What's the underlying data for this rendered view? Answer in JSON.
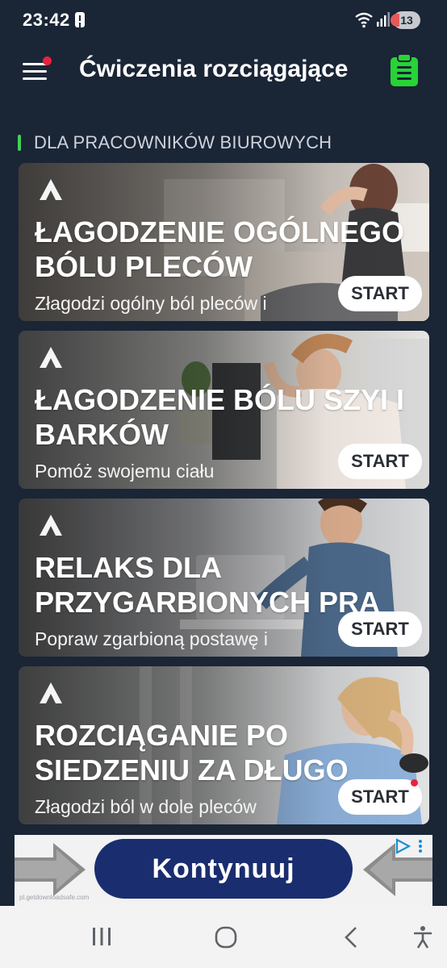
{
  "status": {
    "time": "23:42",
    "battery": "13"
  },
  "app": {
    "title": "Ćwiczenia rozciągające"
  },
  "section": {
    "title": "DLA PRACOWNIKÓW BIUROWYCH"
  },
  "cards": [
    {
      "title": "ŁAGODZENIE OGÓLNEGO BÓLU PLECÓW",
      "subtitle": "Złagodzi ogólny ból pleców i",
      "button": "START"
    },
    {
      "title": "ŁAGODZENIE BÓLU SZYI I BARKÓW",
      "subtitle": "Pomóż swojemu ciału",
      "button": "START"
    },
    {
      "title": "RELAKS DLA PRZYGARBIONYCH PRA",
      "subtitle": "Popraw zgarbioną postawę i",
      "button": "START"
    },
    {
      "title": "ROZCIĄGANIE PO SIEDZENIU ZA DŁUGO",
      "subtitle": "Złagodzi ból w dole pleców",
      "button": "START"
    }
  ],
  "ad": {
    "button": "Kontynuuj",
    "url": "pl.getdownloadsafe.com"
  },
  "icons": {
    "menu": "hamburger-menu-icon",
    "clipboard": "clipboard-list-icon",
    "recents": "recent-apps-icon",
    "home": "home-icon",
    "back": "back-icon",
    "accessibility": "accessibility-icon"
  },
  "colors": {
    "background": "#1a2536",
    "accent_green": "#3ed35b",
    "notification_red": "#e8223e",
    "ad_button": "#1a2d6e"
  }
}
